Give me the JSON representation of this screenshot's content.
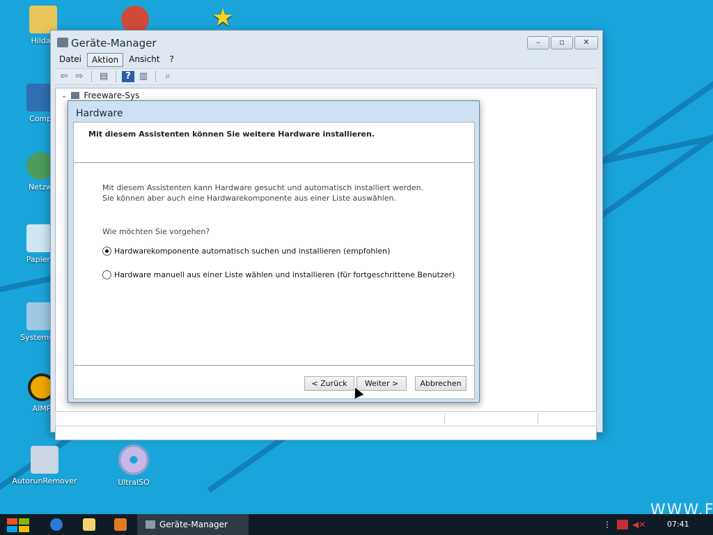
{
  "desktop": {
    "icons": [
      {
        "label": "Hildab",
        "icon": "user-folder-icon"
      },
      {
        "label": "Comp",
        "icon": "computer-icon"
      },
      {
        "label": "Netzw",
        "icon": "network-icon"
      },
      {
        "label": "Papierk",
        "icon": "recycle-bin-icon"
      },
      {
        "label": "Systemste",
        "icon": "control-panel-icon"
      },
      {
        "label": "AIMP",
        "icon": "aimp-icon"
      },
      {
        "label": "AutorunRemover",
        "icon": "autorun-remover-icon"
      },
      {
        "label": "UltraISO",
        "icon": "disc-icon"
      }
    ],
    "watermark": "WWW.FR"
  },
  "device_manager": {
    "title": "Geräte-Manager",
    "menu": [
      "Datei",
      "Aktion",
      "Ansicht",
      "?"
    ],
    "active_menu": "Aktion",
    "tree_root": "Freeware-Sys"
  },
  "hardware_dialog": {
    "title": "Hardware",
    "header": "Mit diesem Assistenten können Sie weitere Hardware installieren.",
    "description": "Mit diesem Assistenten kann Hardware gesucht und automatisch installiert werden. Sie können aber auch eine Hardwarekomponente aus einer Liste auswählen.",
    "question": "Wie möchten Sie vorgehen?",
    "options": [
      {
        "label": "Hardwarekomponente automatisch suchen und installieren (empfohlen)",
        "checked": true
      },
      {
        "label": "Hardware manuell aus einer Liste wählen und installieren (für fortgeschrittene Benutzer)",
        "checked": false
      }
    ],
    "buttons": {
      "back": "< Zurück",
      "next": "Weiter >",
      "cancel": "Abbrechen"
    }
  },
  "taskbar": {
    "task_label": "Geräte-Manager",
    "clock": "07:41"
  },
  "colors": {
    "desktop": "#1aa5da",
    "taskbar": "#0f1c26"
  }
}
